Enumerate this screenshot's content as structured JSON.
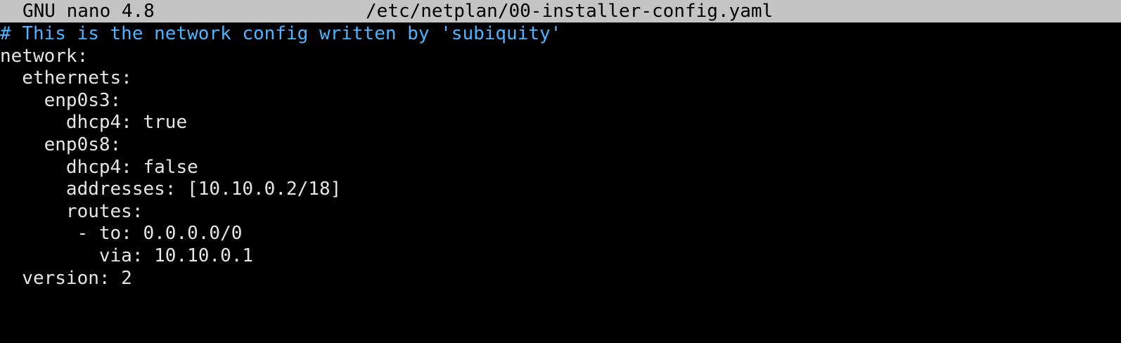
{
  "title_bar": {
    "app_name": "GNU nano 4.8",
    "file_path": "/etc/netplan/00-installer-config.yaml"
  },
  "colors": {
    "title_bg": "#c4c4c4",
    "comment": "#4fb3ff",
    "text": "#e6e6e6",
    "background": "#000000"
  },
  "editor": {
    "lines": [
      {
        "text": "# This is the network config written by 'subiquity'",
        "kind": "comment"
      },
      {
        "text": "network:",
        "kind": "text"
      },
      {
        "text": "  ethernets:",
        "kind": "text"
      },
      {
        "text": "    enp0s3:",
        "kind": "text"
      },
      {
        "text": "      dhcp4: true",
        "kind": "text"
      },
      {
        "text": "    enp0s8:",
        "kind": "text"
      },
      {
        "text": "      dhcp4: false",
        "kind": "text"
      },
      {
        "text": "      addresses: [10.10.0.2/18]",
        "kind": "text"
      },
      {
        "text": "      routes:",
        "kind": "text"
      },
      {
        "text": "       - to: 0.0.0.0/0",
        "kind": "text"
      },
      {
        "text": "         via: 10.10.0.1",
        "kind": "text"
      },
      {
        "text": "  version: 2",
        "kind": "text"
      }
    ]
  }
}
